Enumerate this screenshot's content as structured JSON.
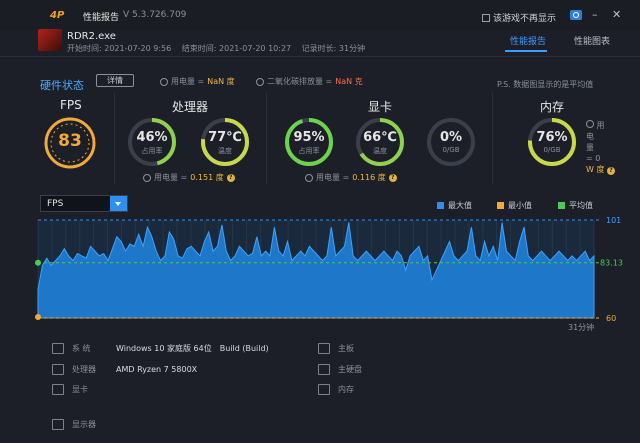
{
  "titlebar": {
    "logo": "4P",
    "title": "性能报告",
    "version": "V 5.3.726.709",
    "no_show_label": "该游戏不再显示",
    "minimize": "–",
    "close": "✕"
  },
  "app": {
    "name": "RDR2.exe",
    "start": "开始时间: 2021-07-20 9:56",
    "end": "结束时间: 2021-07-20 10:27",
    "duration": "记录时长: 31分钟"
  },
  "tabs": [
    {
      "label": "性能报告",
      "active": true
    },
    {
      "label": "性能图表",
      "active": false
    }
  ],
  "status": {
    "title": "硬件状态",
    "detail_button": "详情",
    "power_label": "用电量 =",
    "power_value": "NaN 度",
    "co2_label": "二氧化碳排放量 =",
    "co2_value": "NaN 克",
    "ps_note": "P.S. 数据图显示的是平均值"
  },
  "fps": {
    "title": "FPS",
    "value": "83"
  },
  "cpu": {
    "title": "处理器",
    "usage_value": "46%",
    "usage_label": "占用率",
    "usage_fraction": 0.46,
    "temp_value": "77℃",
    "temp_label": "温度",
    "temp_fraction": 0.77,
    "power_label": "用电量 =",
    "power_value": "0.151 度"
  },
  "gpu": {
    "title": "显卡",
    "usage_value": "95%",
    "usage_label": "占用率",
    "usage_fraction": 0.95,
    "temp_value": "66℃",
    "temp_label": "温度",
    "temp_fraction": 0.66,
    "vram_value": "0%",
    "vram_label": "0/GB",
    "vram_fraction": 0,
    "power_label": "用电量 =",
    "power_value": "0.116 度"
  },
  "memory": {
    "title": "内存",
    "usage_value": "76%",
    "usage_label": "0/GB",
    "usage_fraction": 0.76,
    "side_line1": "用",
    "side_line2": "电",
    "side_line3": "量",
    "side_line4": "= 0",
    "side_line5": "W 度"
  },
  "chart_controls": {
    "metric_selected": "FPS",
    "legend": [
      {
        "label": "最大值",
        "color": "#2f8ff0"
      },
      {
        "label": "最小值",
        "color": "#f2a93a"
      },
      {
        "label": "平均值",
        "color": "#4cc95a"
      }
    ]
  },
  "chart_data": {
    "type": "area",
    "series": [
      {
        "name": "FPS",
        "values": [
          72,
          82,
          85,
          82,
          84,
          86,
          89,
          86,
          84,
          87,
          86,
          85,
          90,
          88,
          86,
          87,
          84,
          89,
          94,
          92,
          88,
          91,
          90,
          95,
          90,
          98,
          94,
          88,
          84,
          86,
          96,
          93,
          86,
          85,
          89,
          90,
          88,
          86,
          92,
          96,
          88,
          90,
          99,
          88,
          84,
          86,
          90,
          88,
          86,
          87,
          94,
          86,
          88,
          86,
          98,
          88,
          86,
          92,
          84,
          86,
          88,
          86,
          90,
          88,
          86,
          84,
          86,
          98,
          86,
          88,
          90,
          100,
          86,
          84,
          86,
          88,
          86,
          84,
          86,
          88,
          86,
          84,
          88,
          86,
          80,
          86,
          88,
          90,
          84,
          86,
          76,
          80,
          84,
          88,
          92,
          86,
          84,
          86,
          88,
          98,
          86,
          84,
          92,
          86,
          90,
          84,
          100,
          88,
          86,
          84,
          92,
          98,
          86,
          84,
          86,
          88,
          86,
          84,
          86,
          88,
          86,
          84,
          86,
          84,
          86,
          88,
          84,
          86
        ]
      }
    ],
    "max_value": "101",
    "avg_value": "83.13",
    "min_value": "60",
    "ylim": [
      60,
      101
    ],
    "x_end_label": "31分钟"
  },
  "system_info": {
    "os_label": "系    统",
    "os_value": "Windows 10 家庭版 64位",
    "os_build": "Build (Build)",
    "cpu_label": "处理器",
    "cpu_value": "AMD Ryzen 7 5800X",
    "gpu_label": "显卡",
    "board_label": "主板",
    "disk_label": "主硬盘",
    "ram_label": "内存",
    "monitor_label": "显示器"
  }
}
